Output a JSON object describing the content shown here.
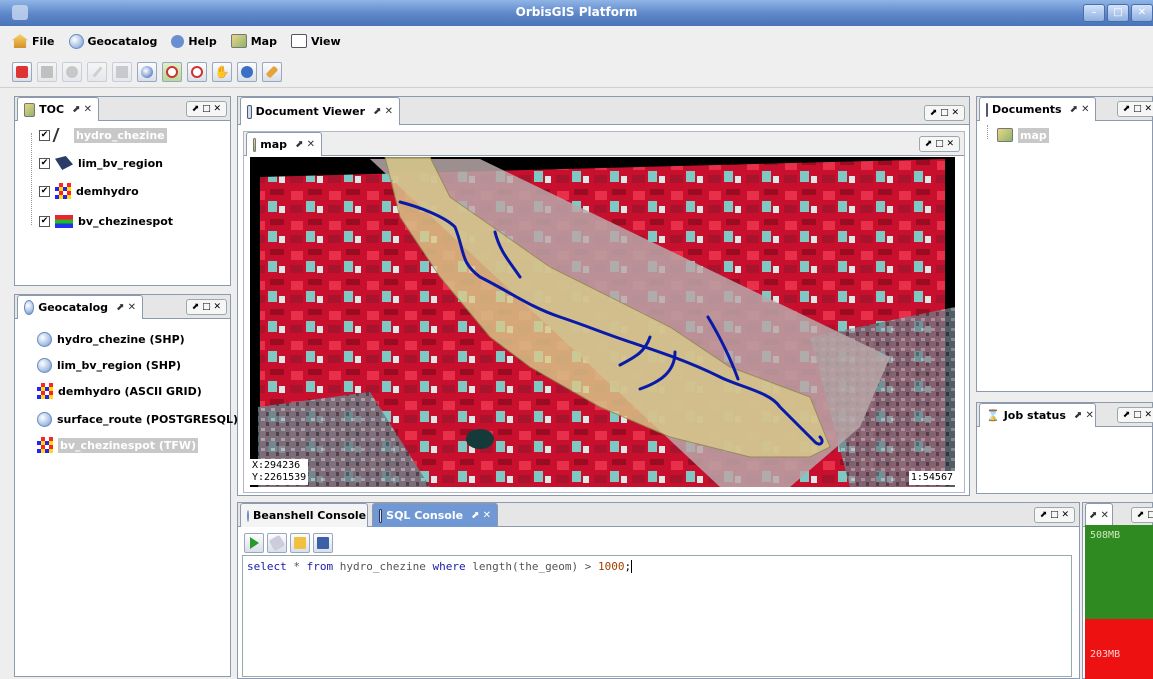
{
  "window": {
    "title": "OrbisGIS Platform"
  },
  "menu": [
    "File",
    "Geocatalog",
    "Help",
    "Map",
    "View"
  ],
  "toolbar": {
    "buttons": [
      "stop",
      "square",
      "disk",
      "pen",
      "table",
      "globe",
      "zoom-in",
      "zoom-out",
      "pan",
      "info",
      "edit"
    ]
  },
  "toc": {
    "tab": "TOC",
    "layers": [
      {
        "name": "hydro_chezine",
        "checked": true,
        "selected": true
      },
      {
        "name": "lim_bv_region",
        "checked": true
      },
      {
        "name": "demhydro",
        "checked": true
      },
      {
        "name": "bv_chezinespot",
        "checked": true
      }
    ]
  },
  "geocatalog": {
    "tab": "Geocatalog",
    "sources": [
      {
        "name": "hydro_chezine (SHP)"
      },
      {
        "name": "lim_bv_region (SHP)"
      },
      {
        "name": "demhydro (ASCII GRID)"
      },
      {
        "name": "surface_route (POSTGRESQL)"
      },
      {
        "name": "bv_chezinespot (TFW)",
        "selected": true
      }
    ]
  },
  "document_viewer": {
    "tab": "Document Viewer",
    "map_tab": "map"
  },
  "map": {
    "coord_x": "X:294236",
    "coord_y": "Y:2261539",
    "scale": "1:54567"
  },
  "documents": {
    "tab": "Documents",
    "items": [
      "map"
    ]
  },
  "job_status": {
    "tab": "Job status"
  },
  "console": {
    "tabs": [
      "Beanshell Console",
      "SQL Console"
    ],
    "sql_parts": {
      "k1": "select",
      "star": " * ",
      "k2": "from",
      "table": " hydro_chezine ",
      "k3": "where",
      "expr": " length(the_geom) > ",
      "num": "1000",
      "end": ";"
    }
  },
  "memory": {
    "used": "508MB",
    "free": "203MB"
  },
  "dock_controls": "⬈ □ ✕",
  "tab_controls": "⬈ ✕"
}
